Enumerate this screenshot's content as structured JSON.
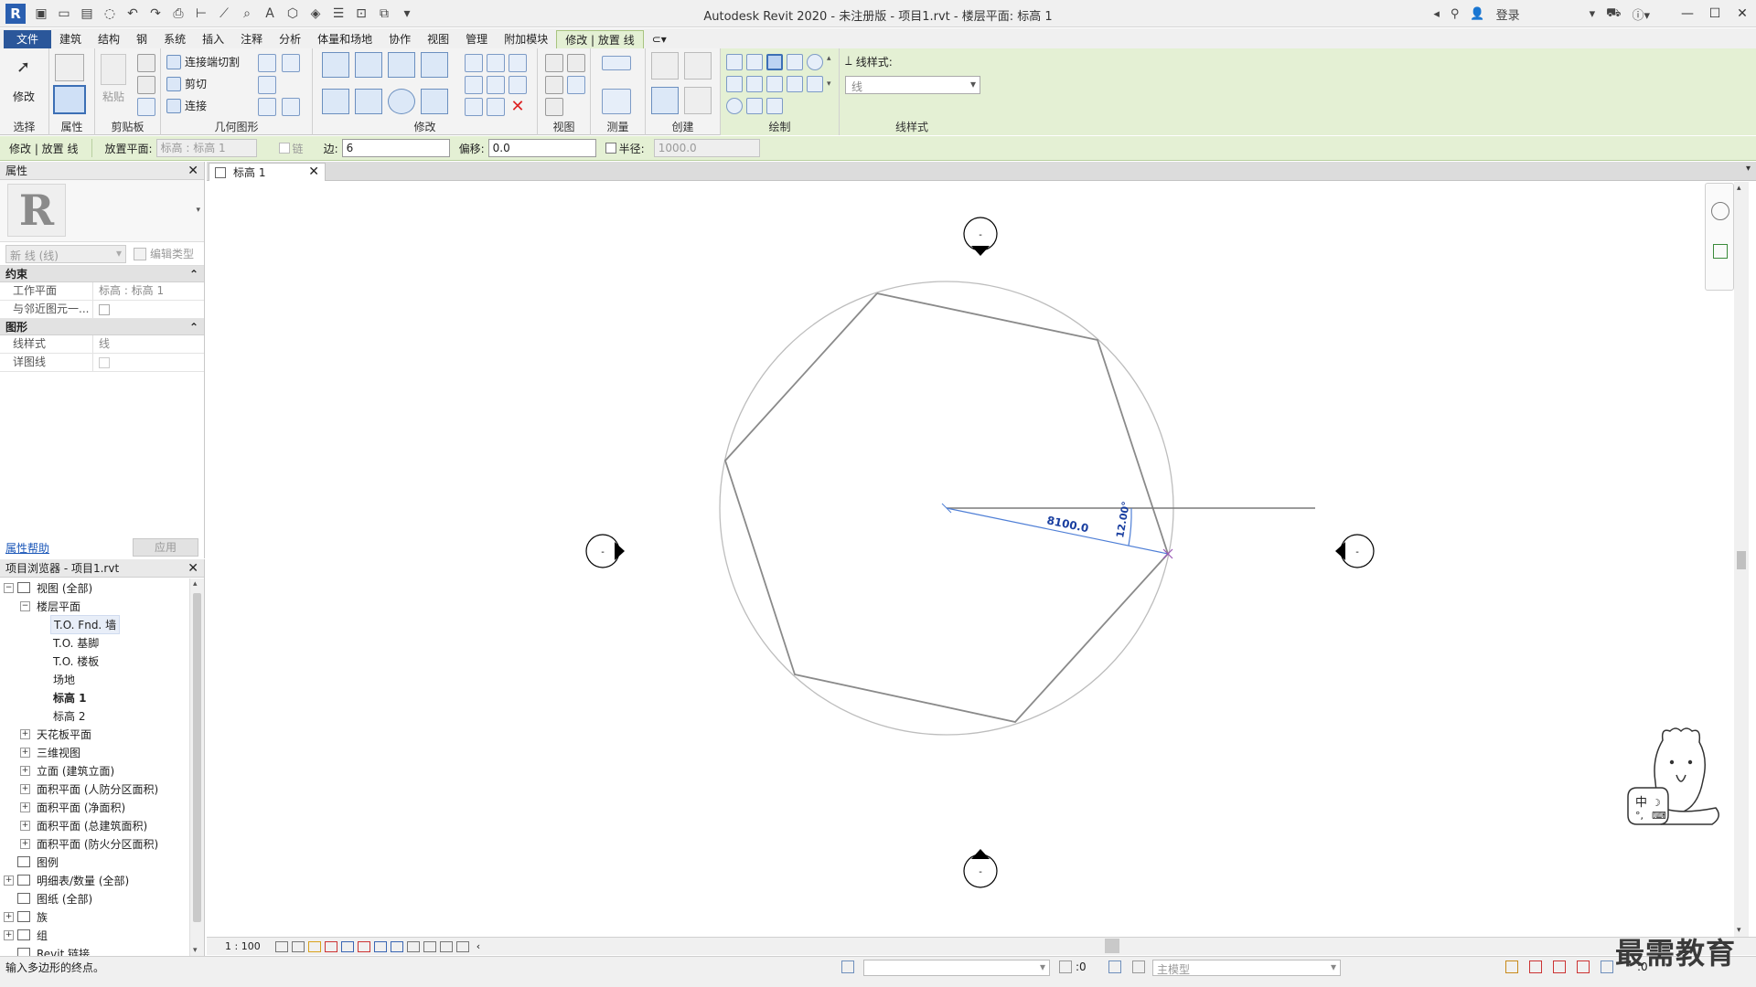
{
  "window": {
    "title": "Autodesk Revit 2020 - 未注册版 - 项目1.rvt - 楼层平面: 标高 1",
    "login_label": "登录"
  },
  "ribbon": {
    "tabs": [
      "文件",
      "建筑",
      "结构",
      "钢",
      "系统",
      "插入",
      "注释",
      "分析",
      "体量和场地",
      "协作",
      "视图",
      "管理",
      "附加模块",
      "修改 | 放置 线"
    ],
    "active_tab": "修改 | 放置 线",
    "groups": {
      "select": "选择",
      "properties": "属性",
      "clipboard": "剪贴板",
      "geometry": "几何图形",
      "modify": "修改",
      "view": "视图",
      "measure": "测量",
      "create": "创建",
      "draw": "绘制",
      "line_style_group": "线样式"
    },
    "buttons": {
      "modify": "修改",
      "paste": "粘贴",
      "cut_join": "连接端切割",
      "cut": "剪切",
      "join": "连接"
    },
    "line_style_label": "线样式:",
    "line_style_value": "线"
  },
  "options_bar": {
    "context": "修改 | 放置 线",
    "placement_plane_label": "放置平面:",
    "placement_plane_value": "标高 : 标高 1",
    "chain_label": "链",
    "sides_label": "边:",
    "sides_value": "6",
    "offset_label": "偏移:",
    "offset_value": "0.0",
    "radius_label": "半径:",
    "radius_value": "1000.0"
  },
  "properties": {
    "title": "属性",
    "type_filter": "新 线 (线)",
    "edit_type": "编辑类型",
    "sections": [
      {
        "name": "约束",
        "rows": [
          {
            "name": "工作平面",
            "value": "标高 : 标高 1"
          },
          {
            "name": "与邻近图元一...",
            "value": ""
          }
        ]
      },
      {
        "name": "图形",
        "rows": [
          {
            "name": "线样式",
            "value": "线"
          },
          {
            "name": "详图线",
            "value": ""
          }
        ]
      }
    ],
    "help_link": "属性帮助",
    "apply_button": "应用"
  },
  "browser": {
    "title": "项目浏览器 - 项目1.rvt",
    "nodes": [
      {
        "label": "视图 (全部)",
        "level": 0,
        "expand": "-"
      },
      {
        "label": "楼层平面",
        "level": 1,
        "expand": "-"
      },
      {
        "label": "T.O. Fnd. 墙",
        "level": 2,
        "expand": ""
      },
      {
        "label": "T.O. 基脚",
        "level": 2,
        "expand": ""
      },
      {
        "label": "T.O. 楼板",
        "level": 2,
        "expand": ""
      },
      {
        "label": "场地",
        "level": 2,
        "expand": ""
      },
      {
        "label": "标高 1",
        "level": 2,
        "expand": ""
      },
      {
        "label": "标高 2",
        "level": 2,
        "expand": ""
      },
      {
        "label": "天花板平面",
        "level": 1,
        "expand": "+"
      },
      {
        "label": "三维视图",
        "level": 1,
        "expand": "+"
      },
      {
        "label": "立面 (建筑立面)",
        "level": 1,
        "expand": "+"
      },
      {
        "label": "面积平面 (人防分区面积)",
        "level": 1,
        "expand": "+"
      },
      {
        "label": "面积平面 (净面积)",
        "level": 1,
        "expand": "+"
      },
      {
        "label": "面积平面 (总建筑面积)",
        "level": 1,
        "expand": "+"
      },
      {
        "label": "面积平面 (防火分区面积)",
        "level": 1,
        "expand": "+"
      },
      {
        "label": "图例",
        "level": 0,
        "expand": ""
      },
      {
        "label": "明细表/数量 (全部)",
        "level": 0,
        "expand": "+"
      },
      {
        "label": "图纸 (全部)",
        "level": 0,
        "expand": ""
      },
      {
        "label": "族",
        "level": 0,
        "expand": "+"
      },
      {
        "label": "组",
        "level": 0,
        "expand": "+"
      },
      {
        "label": "Revit 链接",
        "level": 0,
        "expand": ""
      }
    ]
  },
  "view": {
    "tab_label": "标高 1",
    "dimension_text": "8100.0",
    "angle_text": "12.00°",
    "marker_text": "-",
    "scale": "1 : 100"
  },
  "status": {
    "message": "输入多边形的终点。",
    "workset_count": ":0",
    "model_combo": "主模型",
    "filter_count": ":0"
  },
  "overlay": {
    "ime_label": "中",
    "watermark": "最需教育"
  }
}
